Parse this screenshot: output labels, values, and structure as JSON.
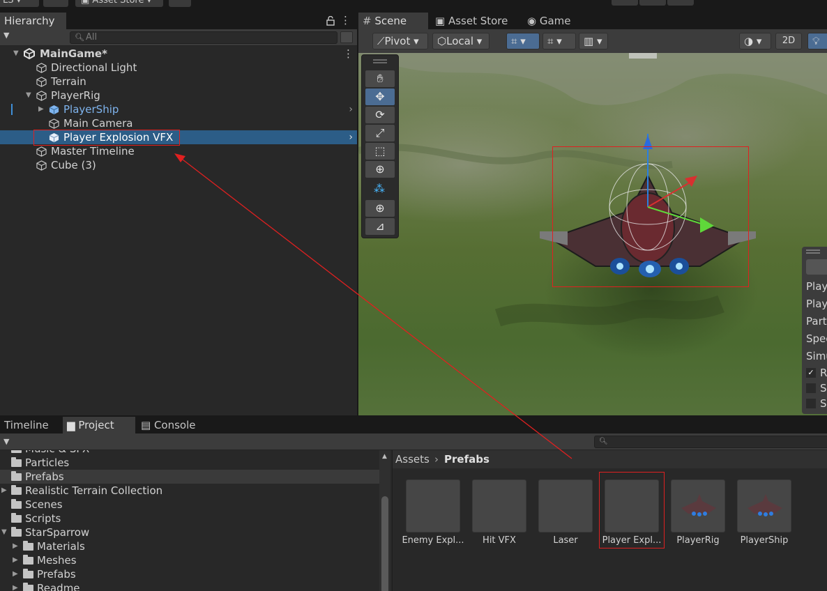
{
  "toolbar": {
    "account_label": "LS",
    "asset_store_label": "Asset Store"
  },
  "hierarchy": {
    "tab_label": "Hierarchy",
    "search_placeholder": "All",
    "scene_name": "MainGame*",
    "items": [
      {
        "label": "Directional Light"
      },
      {
        "label": "Terrain"
      },
      {
        "label": "PlayerRig"
      },
      {
        "label": "PlayerShip"
      },
      {
        "label": "Main Camera"
      },
      {
        "label": "Player Explosion VFX"
      },
      {
        "label": "Master Timeline"
      },
      {
        "label": "Cube (3)"
      }
    ]
  },
  "scene": {
    "tabs": [
      {
        "label": "Scene"
      },
      {
        "label": "Asset Store"
      },
      {
        "label": "Game"
      }
    ],
    "pivot_label": "Pivot",
    "local_label": "Local",
    "mode_2d_label": "2D",
    "overlay_rows": [
      "Play",
      "Play",
      "Part",
      "Spee",
      "Simu",
      "R",
      "S",
      "S"
    ]
  },
  "bottom": {
    "tabs": [
      {
        "label": "Timeline"
      },
      {
        "label": "Project"
      },
      {
        "label": "Console"
      }
    ],
    "tree": [
      {
        "label": "Music & SFX"
      },
      {
        "label": "Particles"
      },
      {
        "label": "Prefabs"
      },
      {
        "label": "Realistic Terrain Collection"
      },
      {
        "label": "Scenes"
      },
      {
        "label": "Scripts"
      },
      {
        "label": "StarSparrow"
      },
      {
        "label": "Materials"
      },
      {
        "label": "Meshes"
      },
      {
        "label": "Prefabs"
      },
      {
        "label": "Readme"
      }
    ],
    "breadcrumb": {
      "root": "Assets",
      "current": "Prefabs"
    },
    "assets": [
      {
        "label": "Enemy Expl..."
      },
      {
        "label": "Hit VFX"
      },
      {
        "label": "Laser"
      },
      {
        "label": "Player Expl..."
      },
      {
        "label": "PlayerRig"
      },
      {
        "label": "PlayerShip"
      }
    ]
  },
  "colors": {
    "selection": "#2c5d87",
    "prefab_blue": "#7fb4ee",
    "annotation_red": "#e02020",
    "panel": "#282828",
    "toolbar": "#3c3c3c"
  }
}
